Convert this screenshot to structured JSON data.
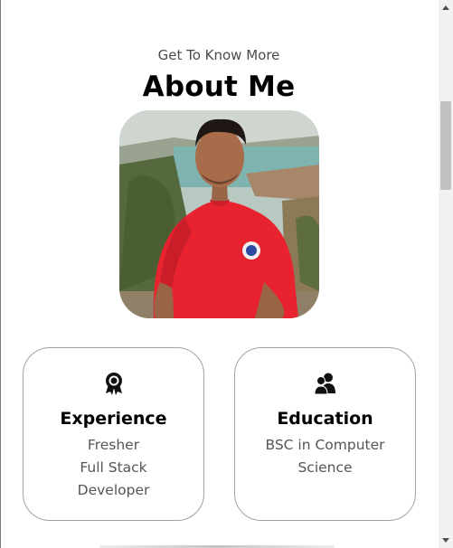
{
  "header": {
    "subtitle": "Get To Know More",
    "title": "About Me"
  },
  "profile_photo": {
    "alt": "Profile picture"
  },
  "cards": [
    {
      "icon": "award-ribbon-icon",
      "title": "Experience",
      "lines": [
        "Fresher",
        "Full Stack",
        "Developer"
      ]
    },
    {
      "icon": "user-group-icon",
      "title": "Education",
      "lines": [
        "BSC in Computer",
        "Science"
      ]
    }
  ],
  "colors": {
    "text": "#000000",
    "muted": "#555555",
    "card_border": "#a3a3a3",
    "shirt": "#e8232f"
  }
}
